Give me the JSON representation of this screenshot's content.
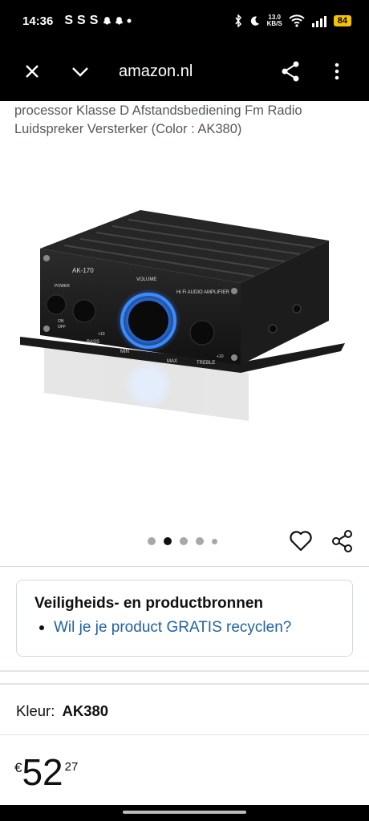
{
  "status_bar": {
    "time": "14:36",
    "left_icons": [
      "S",
      "S",
      "S"
    ],
    "net_speed_value": "13.0",
    "net_speed_unit": "KB/S",
    "battery": "84"
  },
  "browser": {
    "url": "amazon.nl"
  },
  "product": {
    "title": "processor Klasse D Afstandsbediening Fm Radio Luidspreker Versterker (Color : AK380)",
    "image_labels": {
      "model": "AK-170",
      "power": "POWER",
      "on": "ON",
      "off": "OFF",
      "volume": "VOLUME",
      "amplifier": "Hi Fi AUDIO AMPLIFIER",
      "bass": "BASS",
      "treble": "TREBLE",
      "min": "MIN",
      "max": "MAX",
      "plus10_a": "+10",
      "plus10_b": "+10"
    },
    "carousel": {
      "count": 5,
      "active_index": 1
    }
  },
  "safety": {
    "title": "Veiligheids- en productbronnen",
    "link": "Wil je je product GRATIS recyclen?"
  },
  "variant": {
    "label": "Kleur:",
    "value": "AK380"
  },
  "price": {
    "symbol": "€",
    "whole": "52",
    "fraction": "27"
  },
  "colors": {
    "link": "#2162a1",
    "glow": "#2a7cff",
    "battery": "#f5c400"
  }
}
